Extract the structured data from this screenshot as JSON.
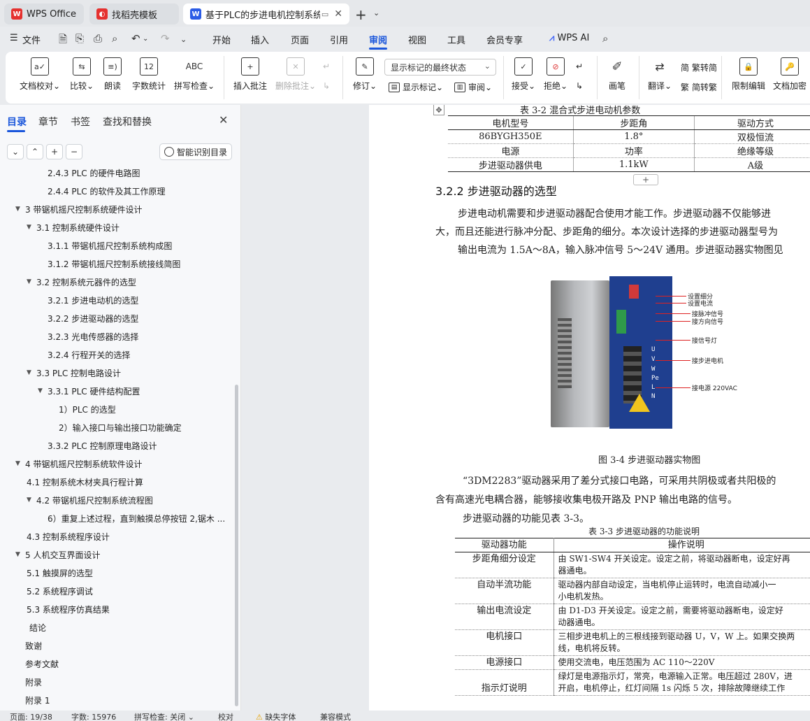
{
  "tabs": [
    {
      "label": "WPS Office",
      "icon": "wps-logo",
      "color": "#e5312f"
    },
    {
      "label": "找稻壳模板",
      "icon": "docer-logo",
      "color": "#e5312f"
    },
    {
      "label": "基于PLC的步进电机控制系统设",
      "icon": "word-doc",
      "color": "#2b5ce6",
      "active": true
    }
  ],
  "menu": {
    "file": "文件",
    "items": [
      "开始",
      "插入",
      "页面",
      "引用",
      "审阅",
      "视图",
      "工具",
      "会员专享"
    ],
    "active": "审阅",
    "wps_ai": "WPS AI"
  },
  "ribbon": {
    "doc_proof": "文档校对",
    "compare": "比较",
    "read_aloud": "朗读",
    "word_count": "字数统计",
    "spell_check": "拼写检查",
    "insert_comment": "插入批注",
    "delete_comment": "删除批注",
    "revise": "修订",
    "markup_mode": "显示标记的最终状态",
    "show_markup": "显示标记",
    "review": "审阅",
    "accept": "接受",
    "reject": "拒绝",
    "pen": "画笔",
    "translate": "翻译",
    "trad_convert": "繁转简",
    "simp_convert": "简转繁",
    "restrict_edit": "限制编辑",
    "doc_encrypt": "文档加密"
  },
  "sidebar": {
    "tabs": [
      "目录",
      "章节",
      "书签",
      "查找和替换"
    ],
    "smart_btn": "智能识别目录",
    "toc": [
      {
        "text": "2.4.3 PLC 的硬件电路图",
        "level": 3,
        "arrow": ""
      },
      {
        "text": "2.4.4 PLC 的软件及其工作原理",
        "level": 3,
        "arrow": ""
      },
      {
        "text": "3  带锯机摇尺控制系统硬件设计",
        "level": 1,
        "arrow": "▼"
      },
      {
        "text": "3.1  控制系统硬件设计",
        "level": 2,
        "arrow": "▼"
      },
      {
        "text": "3.1.1 带锯机摇尺控制系统构成图",
        "level": 3,
        "arrow": ""
      },
      {
        "text": "3.1.2 带锯机摇尺控制系统接线简图",
        "level": 3,
        "arrow": ""
      },
      {
        "text": "3.2  控制系统元器件的选型",
        "level": 2,
        "arrow": "▼"
      },
      {
        "text": "3.2.1 步进电动机的选型",
        "level": 3,
        "arrow": ""
      },
      {
        "text": "3.2.2  步进驱动器的选型",
        "level": 3,
        "arrow": ""
      },
      {
        "text": "3.2.3 光电传感器的选择",
        "level": 3,
        "arrow": ""
      },
      {
        "text": "3.2.4  行程开关的选择",
        "level": 3,
        "arrow": ""
      },
      {
        "text": "3.3 PLC 控制电路设计",
        "level": 2,
        "arrow": "▼"
      },
      {
        "text": "3.3.1 PLC 硬件结构配置",
        "level": 3,
        "arrow": "▼"
      },
      {
        "text": "1）PLC 的选型",
        "level": 4,
        "arrow": ""
      },
      {
        "text": "2）输入接口与输出接口功能确定",
        "level": 4,
        "arrow": ""
      },
      {
        "text": "3.3.2 PLC 控制原理电路设计",
        "level": 3,
        "arrow": ""
      },
      {
        "text": "4  带锯机摇尺控制系统软件设计",
        "level": 1,
        "arrow": "▼"
      },
      {
        "text": "4.1  控制系统木材夹具行程计算",
        "level": 2,
        "arrow": ""
      },
      {
        "text": "4.2 带锯机摇尺控制系统流程图",
        "level": 2,
        "arrow": "▼"
      },
      {
        "text": "6）重复上述过程，直到触摸总停按钮 2,锯木 ...",
        "level": 3,
        "arrow": ""
      },
      {
        "text": "4.3  控制系统程序设计",
        "level": 2,
        "arrow": ""
      },
      {
        "text": "5  人机交互界面设计",
        "level": 1,
        "arrow": "▼"
      },
      {
        "text": "5.1 触摸屏的选型",
        "level": 2,
        "arrow": ""
      },
      {
        "text": "5.2 系统程序调试",
        "level": 2,
        "arrow": ""
      },
      {
        "text": "5.3 系统程序仿真结果",
        "level": 2,
        "arrow": ""
      },
      {
        "text": "结论",
        "level": 1,
        "arrow": ""
      },
      {
        "text": "致谢",
        "level": 0,
        "arrow": ""
      },
      {
        "text": "参考文献",
        "level": 0,
        "arrow": ""
      },
      {
        "text": "附录",
        "level": 0,
        "arrow": ""
      },
      {
        "text": "附录 1",
        "level": 0,
        "arrow": ""
      }
    ]
  },
  "doc": {
    "table1_caption": "表 3-2  混合式步进电动机参数",
    "table1": [
      [
        "电机型号",
        "步距角",
        "驱动方式"
      ],
      [
        "86BYGH350E",
        "1.8°",
        "双极恒流"
      ],
      [
        "电源",
        "功率",
        "绝缘等级"
      ],
      [
        "步进驱动器供电",
        "1.1kW",
        "A级"
      ]
    ],
    "heading": "3.2.2  步进驱动器的选型",
    "para1": "步进电动机需要和步进驱动器配合使用才能工作。步进驱动器不仅能够进",
    "para2": "大，而且还能进行脉冲分配、步距角的细分。本次设计选择的步进驱动器型号为",
    "para3": "输出电流为 1.5A～8A，输入脉冲信号 5～24V 通用。步进驱动器实物图见",
    "photo_labels": [
      "设置细分",
      "设置电流",
      "接脉冲信号",
      "接方向信号",
      "接信号灯",
      "接步进电机",
      "接电源 220VAC"
    ],
    "photo_front_text": [
      "U",
      "V",
      "W",
      "Pe",
      "L",
      "N"
    ],
    "figure_caption": "图 3-4  步进驱动器实物图",
    "para4": "“3DM2283”驱动器采用了差分式接口电路，可采用共阴极或者共阳极的",
    "para5": "含有高速光电耦合器，能够接收集电极开路及 PNP 输出电路的信号。",
    "para6": "步进驱动器的功能见表 3-3。",
    "table2_caption": "表 3-3  步进驱动器的功能说明",
    "table2_header": [
      "驱动器功能",
      "操作说明"
    ],
    "table2": [
      [
        "步距角细分设定",
        "由 SW1-SW4 开关设定。设定之前，将驱动器断电，设定好再",
        "器通电。"
      ],
      [
        "自动半流功能",
        "驱动器内部自动设定，当电机停止运转时，电流自动减小一",
        "小电机发热。"
      ],
      [
        "输出电流设定",
        "由 D1-D3 开关设定。设定之前，需要将驱动器断电，设定好",
        "动器通电。"
      ],
      [
        "电机接口",
        "三相步进电机上的三根线接到驱动器 U，V，W 上。如果交换两",
        "线，电机将反转。"
      ],
      [
        "电源接口",
        "使用交流电，电压范围为 AC 110～220V",
        ""
      ],
      [
        "指示灯说明",
        "绿灯是电源指示灯，常亮，电源输入正常。电压超过 280V，进",
        "开启，电机停止，红灯间隔 1s 闪烁 5 次，排除故障继续工作"
      ]
    ]
  },
  "status": {
    "page": "页面: 19/38",
    "words": "字数: 15976",
    "spell": "拼写检查: 关闭",
    "proof": "校对",
    "missing_font": "缺失字体",
    "compat": "兼容模式"
  }
}
